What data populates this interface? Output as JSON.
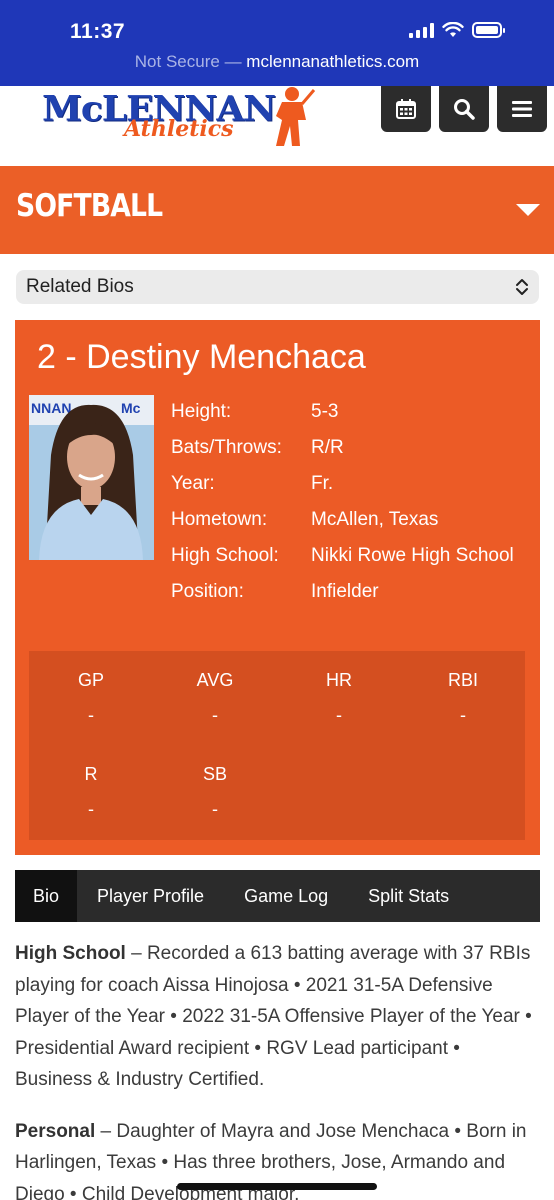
{
  "status_bar": {
    "time": "11:37",
    "not_secure": "Not Secure",
    "separator": "—",
    "url": "mclennanathletics.com"
  },
  "header": {
    "logo_word": "McLENNAN",
    "logo_sub": "Athletics",
    "buttons": [
      "calendar-icon",
      "search-icon",
      "menu-icon"
    ]
  },
  "sport": {
    "title": "SOFTBALL"
  },
  "related_bios": {
    "selected": "Related Bios"
  },
  "player": {
    "name": "2 - Destiny Menchaca",
    "info": [
      {
        "label": "Height:",
        "value": "5-3"
      },
      {
        "label": "Bats/Throws:",
        "value": "R/R"
      },
      {
        "label": "Year:",
        "value": "Fr."
      },
      {
        "label": "Hometown:",
        "value": "McAllen, Texas"
      },
      {
        "label": "High School:",
        "value": "Nikki Rowe High School"
      },
      {
        "label": "Position:",
        "value": "Infielder"
      }
    ],
    "stats": [
      {
        "label": "GP",
        "value": "-"
      },
      {
        "label": "AVG",
        "value": "-"
      },
      {
        "label": "HR",
        "value": "-"
      },
      {
        "label": "RBI",
        "value": "-"
      },
      {
        "label": "R",
        "value": "-"
      },
      {
        "label": "SB",
        "value": "-"
      }
    ]
  },
  "tabs": [
    {
      "label": "Bio",
      "active": true
    },
    {
      "label": "Player Profile",
      "active": false
    },
    {
      "label": "Game Log",
      "active": false
    },
    {
      "label": "Split Stats",
      "active": false
    }
  ],
  "bio": {
    "high_school_heading": "High School",
    "high_school_text": " – Recorded a 613 batting average with 37 RBIs playing for coach Aissa Hinojosa • 2021 31-5A Defensive Player of the Year • 2022 31-5A Offensive Player of the Year • Presidential Award recipient • RGV Lead participant • Business & Industry Certified.",
    "personal_heading": "Personal",
    "personal_text": " – Daughter of Mayra and Jose Menchaca • Born in Harlingen, Texas • Has three brothers, Jose, Armando and Diego • Child Development major."
  },
  "colors": {
    "status_blue": "#1f37b8",
    "brand_orange": "#eb5f27",
    "brand_blue": "#2042b0",
    "header_button": "#2c2c2c"
  }
}
